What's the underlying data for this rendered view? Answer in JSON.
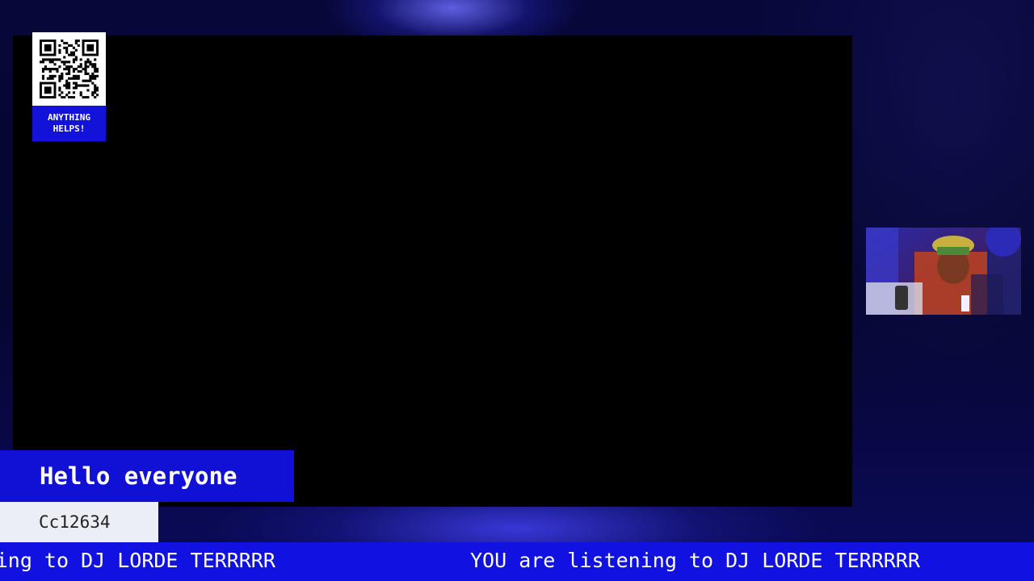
{
  "donation": {
    "caption_line1": "ANYTHING",
    "caption_line2": "HELPS!",
    "qr_icon": "qr-code-icon"
  },
  "chat": {
    "message": "Hello everyone",
    "username": "Cc12634"
  },
  "ticker": {
    "text": "YOU are listening to DJ LORDE TERRRRR"
  },
  "webcam": {
    "description_icon": "webcam-feed"
  },
  "colors": {
    "accent_blue": "#1111e0",
    "background_dark": "#05052e",
    "chat_user_bg": "#eceef5"
  }
}
